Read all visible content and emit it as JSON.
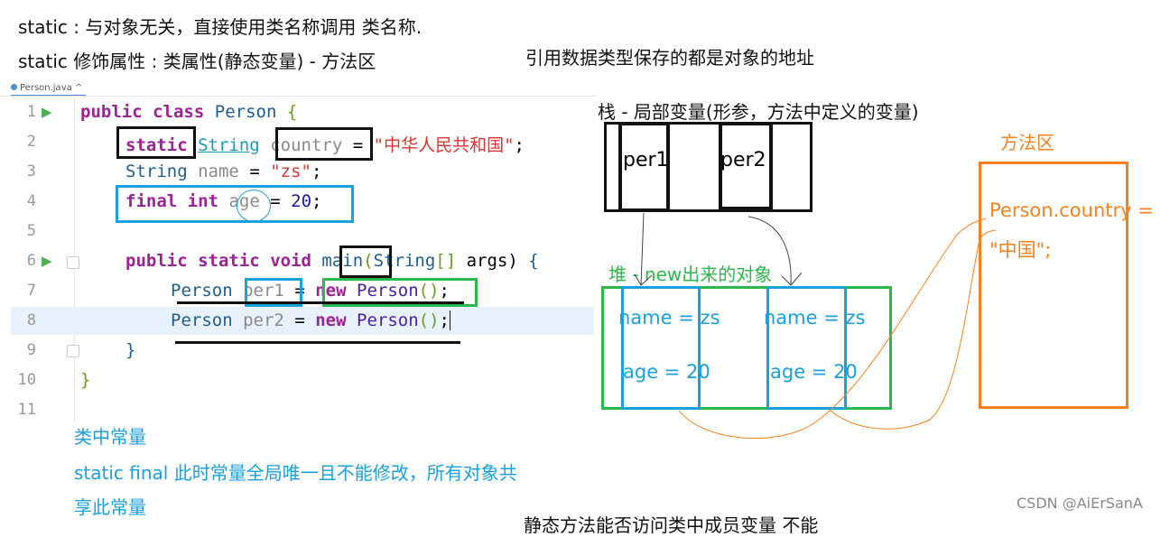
{
  "notes": {
    "static_line1": "static : 与对象无关，直接使用类名称调用 类名称.",
    "static_line2": "static 修饰属性 : 类属性(静态变量) - 方法区",
    "reference_note": "引用数据类型保存的都是对象的地址",
    "constant_title": "类中常量",
    "constant_line1": "static final 此时常量全局唯一且不能修改，所有对象共",
    "constant_line2": "享此常量",
    "bottom_cut": "静态方法能否访问类中成员变量 不能",
    "watermark": "CSDN @AiErSanA"
  },
  "editor": {
    "tab_label": "Person.java",
    "line_numbers": [
      "1",
      "2",
      "3",
      "4",
      "5",
      "6",
      "7",
      "8",
      "9",
      "10",
      "11"
    ],
    "lines": {
      "l1": {
        "kw1": "public",
        "kw2": "class",
        "name": "Person",
        "brace": "{"
      },
      "l2": {
        "kw": "static",
        "type": "String",
        "var": "country",
        "eq": "=",
        "str": "\"中华人民共和国\"",
        "end": ";"
      },
      "l3": {
        "type": "String",
        "var": "name",
        "eq": "=",
        "str": "\"zs\"",
        "end": ";"
      },
      "l4": {
        "kw1": "final",
        "kw2": "int",
        "var": "age",
        "eq": "=",
        "num": "20",
        "end": ";"
      },
      "l6": {
        "kw1": "public",
        "kw2": "static",
        "kw3": "void",
        "method": "main",
        "paren_open": "(",
        "type": "String",
        "brackets": "[]",
        "arg": "args)",
        "brace": "{"
      },
      "l7": {
        "type": "Person",
        "var": "per1",
        "eq": "=",
        "kw": "new",
        "cls": "Person",
        "parens": "()",
        "end": ";"
      },
      "l8": {
        "type": "Person",
        "var": "per2",
        "eq": "=",
        "kw": "new",
        "cls": "Person",
        "parens": "()",
        "end": ";"
      },
      "l9": {
        "brace": "}"
      },
      "l10": {
        "brace": "}"
      }
    }
  },
  "diagram": {
    "stack": {
      "title": "栈 - 局部变量(形参，方法中定义的变量)",
      "slots": [
        "per1",
        "per2"
      ]
    },
    "heap": {
      "title": "堆 - new出来的对象",
      "objects": [
        {
          "name_field": "name = zs",
          "age_field": "age = 20"
        },
        {
          "name_field": "name = zs",
          "age_field": "age = 20"
        }
      ]
    },
    "method_area": {
      "title": "方法区",
      "line1": "Person.country =",
      "line2": "\"中国\";"
    },
    "colors": {
      "black": "#111111",
      "blue": "#1aa0dc",
      "green": "#2db84d",
      "orange": "#f58220"
    }
  }
}
